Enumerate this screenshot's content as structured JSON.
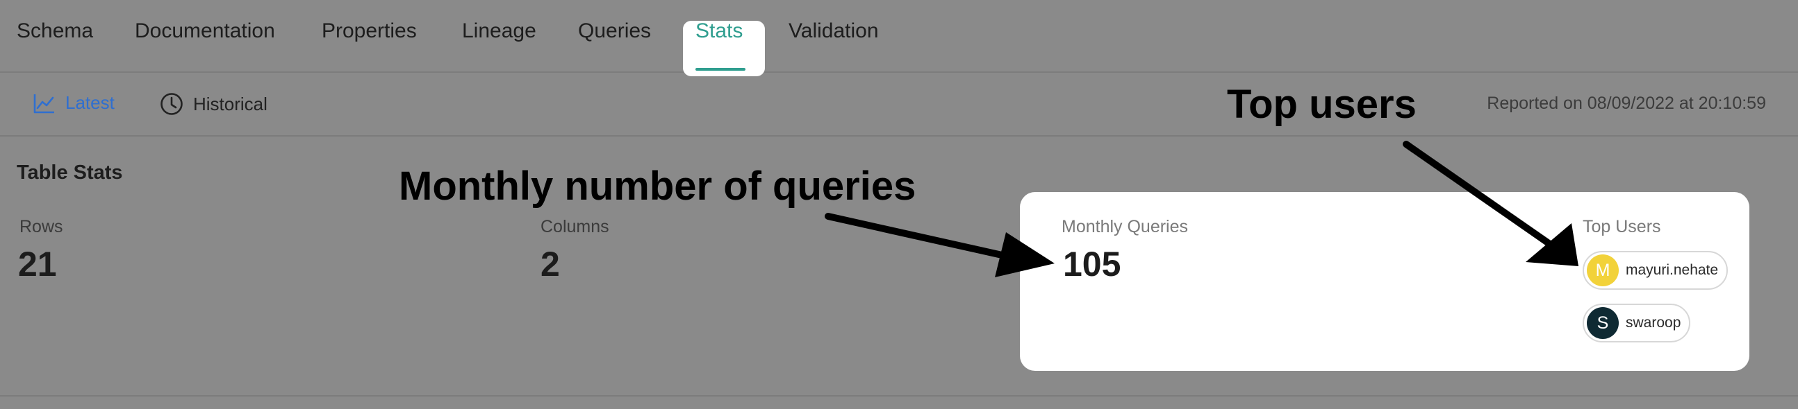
{
  "tabs": {
    "items": [
      {
        "label": "Schema"
      },
      {
        "label": "Documentation"
      },
      {
        "label": "Properties"
      },
      {
        "label": "Lineage"
      },
      {
        "label": "Queries"
      },
      {
        "label": "Stats"
      },
      {
        "label": "Validation"
      }
    ],
    "active": "Stats",
    "accent_color": "#2f9e8f"
  },
  "subtabs": {
    "latest": {
      "label": "Latest",
      "icon": "line-chart-icon",
      "color": "#2f6fd0"
    },
    "historical": {
      "label": "Historical",
      "icon": "clock-icon"
    }
  },
  "reported": "Reported on 08/09/2022 at 20:10:59",
  "table_stats": {
    "title": "Table Stats",
    "rows": {
      "label": "Rows",
      "value": "21"
    },
    "columns": {
      "label": "Columns",
      "value": "2"
    }
  },
  "highlight_card": {
    "monthly_queries": {
      "label": "Monthly Queries",
      "value": "105"
    },
    "top_users": {
      "label": "Top Users",
      "users": [
        {
          "initial": "M",
          "name": "mayuri.nehate",
          "avatar_color": "#f2d23a"
        },
        {
          "initial": "S",
          "name": "swaroop",
          "avatar_color": "#0f2a33"
        }
      ]
    }
  },
  "annotations": {
    "top_users": "Top users",
    "monthly_queries": "Monthly number of queries"
  }
}
